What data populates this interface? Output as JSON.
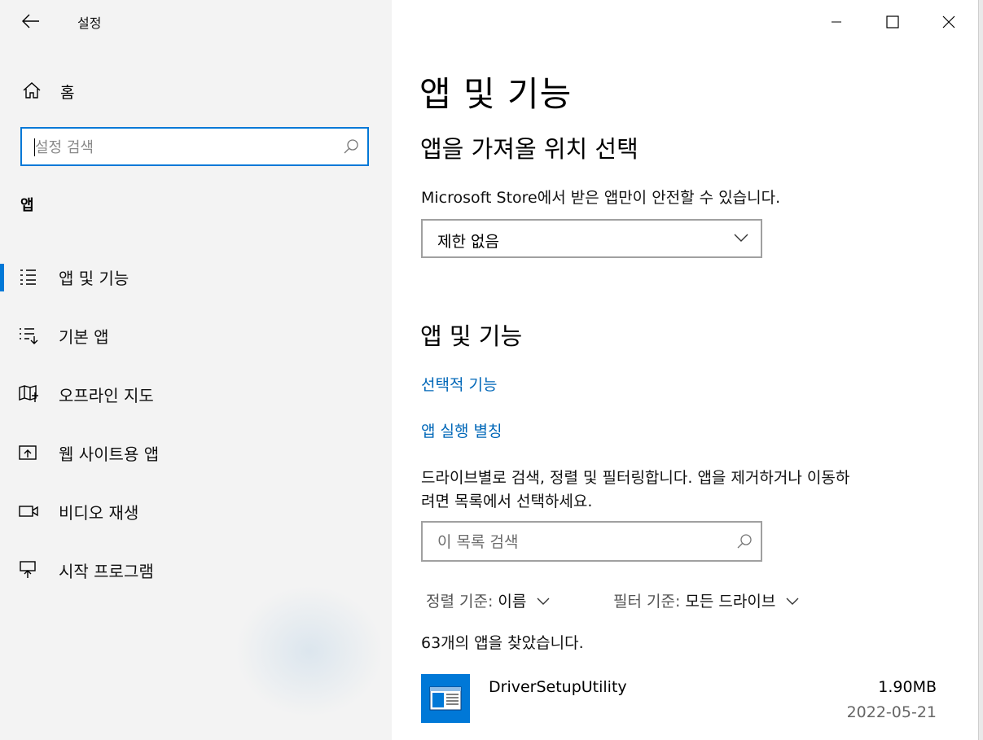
{
  "window": {
    "title": "설정",
    "controls": [
      "minimize",
      "maximize",
      "close"
    ]
  },
  "sidebar": {
    "home_label": "홈",
    "search_placeholder": "설정 검색",
    "section_label": "앱",
    "items": [
      {
        "label": "앱 및 기능",
        "icon": "apps-list-icon",
        "active": true
      },
      {
        "label": "기본 앱",
        "icon": "default-apps-icon",
        "active": false
      },
      {
        "label": "오프라인 지도",
        "icon": "map-icon",
        "active": false
      },
      {
        "label": "웹 사이트용 앱",
        "icon": "open-in-app-icon",
        "active": false
      },
      {
        "label": "비디오 재생",
        "icon": "video-icon",
        "active": false
      },
      {
        "label": "시작 프로그램",
        "icon": "startup-icon",
        "active": false
      }
    ]
  },
  "main": {
    "title": "앱 및 기능",
    "install_source": {
      "heading": "앱을 가져올 위치 선택",
      "description": "Microsoft Store에서 받은 앱만이 안전할 수 있습니다.",
      "dropdown_value": "제한 없음"
    },
    "apps": {
      "heading": "앱 및 기능",
      "optional_features_link": "선택적 기능",
      "aliases_link": "앱 실행 별칭",
      "help_text_line1": "드라이브별로 검색, 정렬 및 필터링합니다. 앱을 제거하거나 이동하",
      "help_text_line2": "려면 목록에서 선택하세요.",
      "search_placeholder": "이 목록 검색",
      "sort_label": "정렬 기준:",
      "sort_value": "이름",
      "filter_label": "필터 기준:",
      "filter_value": "모든 드라이브",
      "count_text": "63개의 앱을 찾았습니다.",
      "list": [
        {
          "name": "DriverSetupUtility",
          "size": "1.90MB",
          "date": "2022-05-21"
        }
      ]
    }
  },
  "colors": {
    "accent": "#0078d7",
    "link": "#0067b8",
    "sidebar_bg": "#f3f3f3"
  }
}
